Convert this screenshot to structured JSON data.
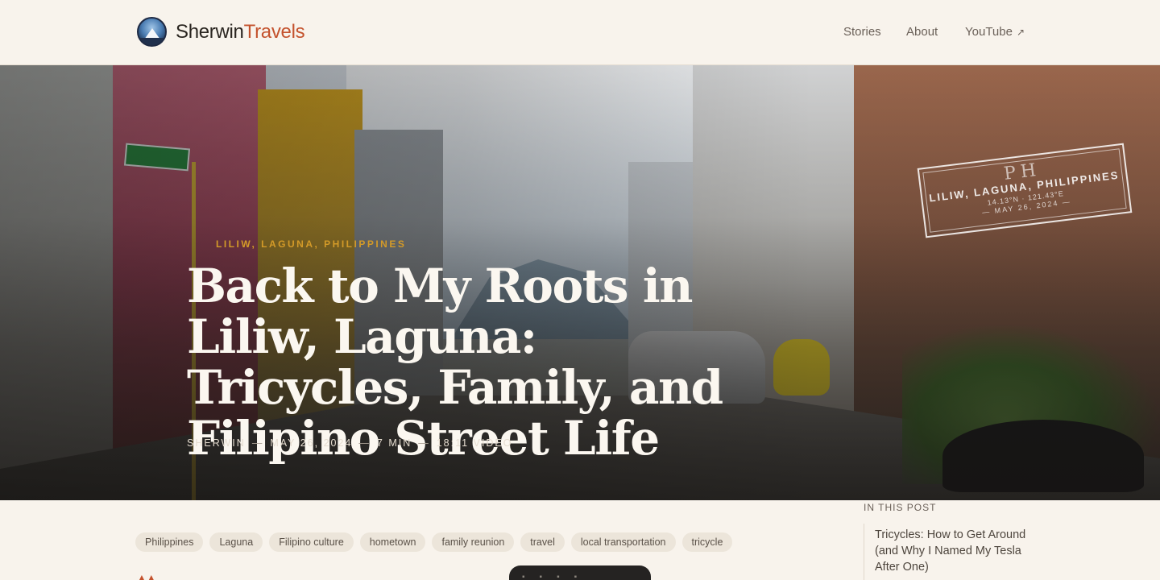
{
  "header": {
    "brand_part1": "Sherwin",
    "brand_part2": "Travels",
    "nav": [
      {
        "label": "Stories"
      },
      {
        "label": "About"
      },
      {
        "label": "YouTube",
        "icon": "external-arrow-icon"
      }
    ]
  },
  "hero": {
    "stamp": {
      "country_code": "PH",
      "place": "LILIW, LAGUNA, PHILIPPINES",
      "coords": "14.13°N · 121.43°E",
      "date": "— MAY 26, 2024 —"
    },
    "kicker": "LILIW, LAGUNA, PHILIPPINES",
    "title": "Back to My Roots in Liliw, Laguna: Tricycles, Family, and Filipino Street Life",
    "meta": {
      "author": "SHERWIN",
      "date": "MAY 26, 2024",
      "read_time": "7 MIN",
      "video": "18:11 VIDEO",
      "separator": "—"
    }
  },
  "tags": [
    "Philippines",
    "Laguna",
    "Filipino culture",
    "hometown",
    "family reunion",
    "travel",
    "local transportation",
    "tricycle"
  ],
  "toc": {
    "label": "IN THIS POST",
    "items": [
      "Tricycles: How to Get Around (and Why I Named My Tesla After One)"
    ]
  },
  "colors": {
    "accent": "#c4522d",
    "kicker": "#d39a28",
    "background": "#f8f3ec"
  }
}
